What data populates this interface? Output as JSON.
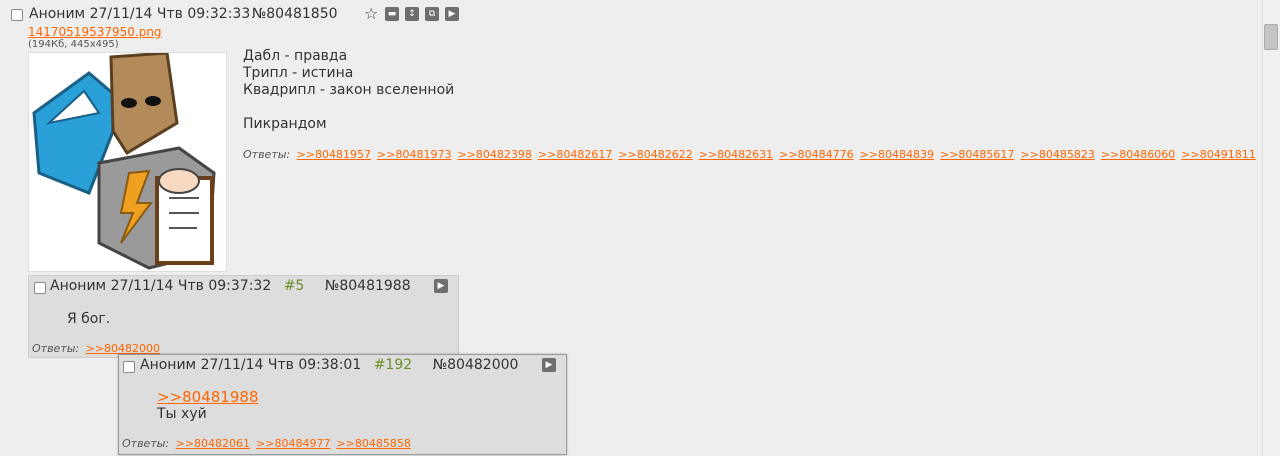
{
  "op": {
    "name": "Аноним",
    "date": "27/11/14 Чтв 09:32:33",
    "num": "№80481850",
    "file_name": "14170519537950.png",
    "file_info": "(194Кб, 445x495)",
    "message": "Дабл - правда\nТрипл - истина\nКвадрипл - закон вселенной\n\nПикрандом",
    "replies_label": "Ответы:",
    "replies": [
      ">>80481957",
      ">>80481973",
      ">>80482398",
      ">>80482617",
      ">>80482622",
      ">>80482631",
      ">>80484776",
      ">>80484839",
      ">>80485617",
      ">>80485823",
      ">>80486060",
      ">>80491811"
    ],
    "icons": [
      "star-icon",
      "hide-icon",
      "expand-icon",
      "new-window-icon",
      "play-icon"
    ]
  },
  "reply1": {
    "name": "Аноним",
    "date": "27/11/14 Чтв 09:37:32",
    "index": "#5",
    "num": "№80481988",
    "message": "Я бог.",
    "replies_label": "Ответы:",
    "replies": [
      ">>80482000"
    ]
  },
  "popup": {
    "name": "Аноним",
    "date": "27/11/14 Чтв 09:38:01",
    "index": "#192",
    "num": "№80482000",
    "quote": ">>80481988",
    "message": "Ты хуй",
    "replies_label": "Ответы:",
    "replies": [
      ">>80482061",
      ">>80484977",
      ">>80485858"
    ]
  },
  "colors": {
    "link": "#ff6600",
    "index": "#6b8e23",
    "bg": "#eeeeee",
    "post_bg": "#dddddd"
  }
}
